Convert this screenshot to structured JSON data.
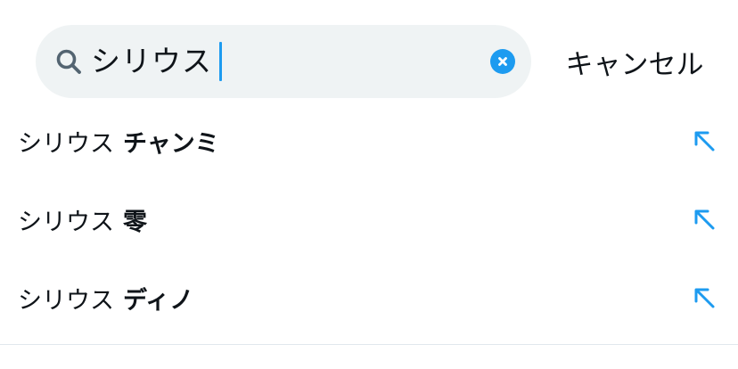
{
  "search": {
    "query": "シリウス",
    "cancel_label": "キャンセル"
  },
  "suggestions": [
    {
      "prefix": "シリウス",
      "completion": "チャンミ"
    },
    {
      "prefix": "シリウス",
      "completion": "零"
    },
    {
      "prefix": "シリウス",
      "completion": "ディノ"
    }
  ],
  "colors": {
    "accent": "#1d9bf0",
    "search_background": "#eff3f4",
    "text": "#0f1419"
  },
  "icons": {
    "search": "search-icon",
    "clear": "clear-icon",
    "fill_suggestion": "arrow-up-left-icon"
  }
}
